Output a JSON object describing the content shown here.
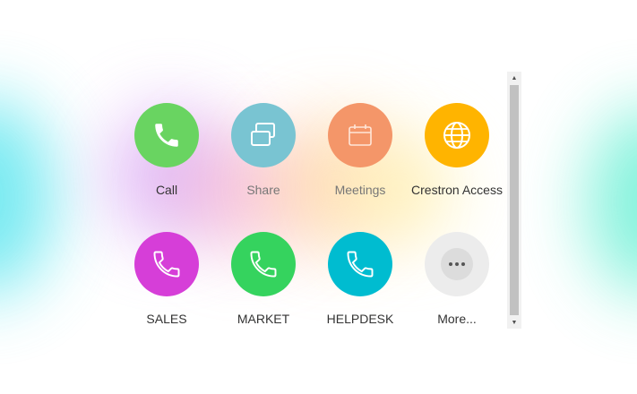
{
  "tiles": [
    {
      "label": "Call",
      "color": "#69d461",
      "icon": "phone-icon"
    },
    {
      "label": "Share",
      "color": "#79c4d2",
      "icon": "share-screens-icon"
    },
    {
      "label": "Meetings",
      "color": "#f49669",
      "icon": "calendar-icon"
    },
    {
      "label": "Crestron Access",
      "color": "#ffb400",
      "icon": "globe-icon"
    },
    {
      "label": "SALES",
      "color": "#d63ed8",
      "icon": "phone-icon"
    },
    {
      "label": "MARKET",
      "color": "#35d35e",
      "icon": "phone-icon"
    },
    {
      "label": "HELPDESK",
      "color": "#00bcd0",
      "icon": "phone-icon"
    },
    {
      "label": "More...",
      "color": "#ececec",
      "icon": "more-icon"
    }
  ],
  "scrollbar": {
    "up_arrow": "▲",
    "down_arrow": "▼"
  }
}
